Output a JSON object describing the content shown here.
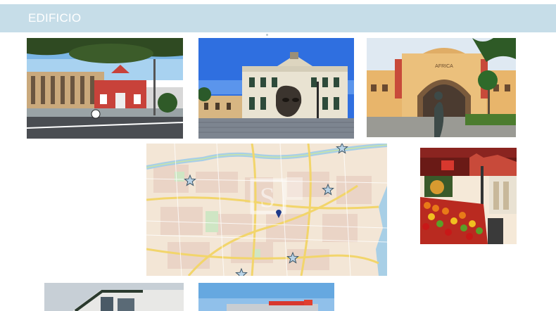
{
  "header": {
    "title": "EDIFICIO"
  },
  "photos": {
    "stadium": {
      "name": "stadium-photo"
    },
    "theater": {
      "name": "theater-plaza-photo"
    },
    "market_gate": {
      "name": "market-gate-photo",
      "sign_text": "AFRICA"
    },
    "fruit_stand": {
      "name": "fruit-stand-photo"
    },
    "building": {
      "name": "modern-building-photo"
    },
    "store": {
      "name": "storefront-photo"
    }
  },
  "map": {
    "markers": [
      "star-marker",
      "star-marker",
      "star-marker",
      "star-marker",
      "star-marker",
      "location-pin"
    ],
    "watermark_icon": "watermark-logo-icon"
  },
  "colors": {
    "header_bg": "#c6dde8",
    "map_bg": "#f3e6d6",
    "road_yellow": "#f2d56b",
    "water": "#a8cfe6"
  }
}
